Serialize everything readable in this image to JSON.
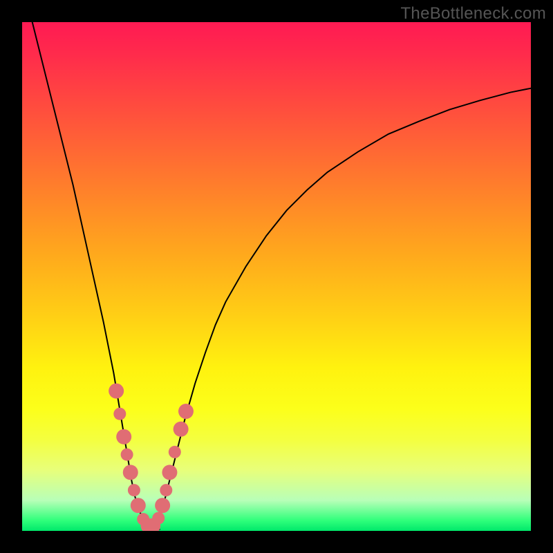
{
  "watermark": "TheBottleneck.com",
  "chart_data": {
    "type": "line",
    "title": "",
    "xlabel": "",
    "ylabel": "",
    "xlim": [
      0,
      100
    ],
    "ylim": [
      0,
      100
    ],
    "grid": false,
    "legend": false,
    "curve_left": {
      "x": [
        2,
        4,
        6,
        8,
        10,
        12,
        14,
        16,
        18,
        19,
        20,
        20.5,
        21,
        21.5,
        22,
        22.5,
        23,
        24,
        25,
        26,
        27
      ],
      "y": [
        100,
        92,
        84,
        76,
        68,
        59,
        50,
        41,
        31,
        25,
        19,
        16,
        13,
        10,
        7.5,
        5.5,
        4,
        2,
        1,
        0.5,
        0.3
      ]
    },
    "curve_right": {
      "x": [
        25,
        26,
        27,
        28,
        29,
        30,
        31,
        32,
        34,
        36,
        38,
        40,
        44,
        48,
        52,
        56,
        60,
        66,
        72,
        78,
        84,
        90,
        96,
        100
      ],
      "y": [
        0.3,
        1,
        3,
        6,
        10,
        14,
        18,
        22,
        29,
        35,
        40.5,
        45,
        52,
        58,
        63,
        67,
        70.5,
        74.5,
        78,
        80.5,
        82.8,
        84.6,
        86.2,
        87
      ]
    },
    "series": [
      {
        "name": "markers-left",
        "x": [
          18.5,
          19.2,
          20.0,
          20.6,
          21.3,
          22.0,
          22.8,
          23.8,
          24.8
        ],
        "y": [
          27.5,
          23.0,
          18.5,
          15.0,
          11.5,
          8.0,
          5.0,
          2.3,
          1.0
        ],
        "marker_r": [
          11,
          9,
          11,
          9,
          11,
          9,
          11,
          9,
          11
        ]
      },
      {
        "name": "markers-right",
        "x": [
          25.7,
          26.8,
          27.6,
          28.3,
          29.0,
          30.0,
          31.2,
          32.2
        ],
        "y": [
          1.0,
          2.5,
          5.0,
          8.0,
          11.5,
          15.5,
          20.0,
          23.5
        ],
        "marker_r": [
          11,
          9,
          11,
          9,
          11,
          9,
          11,
          11
        ]
      }
    ],
    "colors": {
      "curve": "#000000",
      "marker": "#e06d74",
      "gradient_top": "#ff1a53",
      "gradient_bottom": "#00e86b"
    }
  }
}
